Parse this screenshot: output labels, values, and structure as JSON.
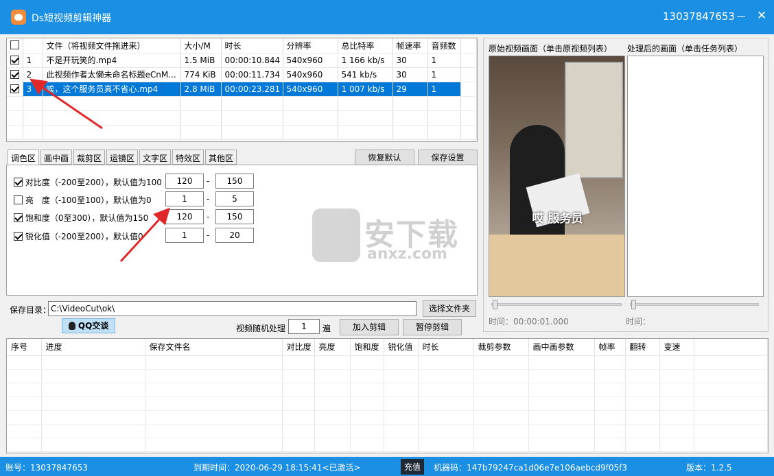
{
  "window": {
    "title": "Ds短视频剪辑神器",
    "account_phone": "13037847653",
    "minimize_icon": "minimize-icon",
    "close_icon": "close-icon",
    "close_glyph": "✕"
  },
  "file_list": {
    "headers": [
      "文件（将视频文件拖进来）",
      "大小/M",
      "时长",
      "分辨率",
      "总比特率",
      "帧速率",
      "音频数"
    ],
    "rows": [
      {
        "no": "1",
        "checked": true,
        "file": "不是开玩笑的.mp4",
        "size": "1.5 MiB",
        "duration": "00:00:10.844",
        "resolution": "540x960",
        "bitrate": "1 166 kb/s",
        "fps": "30",
        "audio": "1"
      },
      {
        "no": "2",
        "checked": true,
        "file": "此视频作者太懒未命名标题eCnM...",
        "size": "774 KiB",
        "duration": "00:00:11.734",
        "resolution": "540x960",
        "bitrate": "541 kb/s",
        "fps": "30",
        "audio": "1"
      },
      {
        "no": "3",
        "checked": true,
        "selected": true,
        "file": "唉，这个服务员真不省心.mp4",
        "size": "2.8 MiB",
        "duration": "00:00:23.281",
        "resolution": "540x960",
        "bitrate": "1 007 kb/s",
        "fps": "29",
        "audio": "1"
      }
    ]
  },
  "tabs": [
    "调色区",
    "画中画",
    "裁剪区",
    "运镜区",
    "文字区",
    "特效区",
    "其他区"
  ],
  "actions": {
    "reset": "恢复默认",
    "save_settings": "保存设置"
  },
  "color_settings": [
    {
      "label": "对比度（-200至200），默认值为100",
      "checked": true,
      "min": "120",
      "max": "150"
    },
    {
      "label": "亮　度（-100至100），默认值为0",
      "checked": false,
      "min": "1",
      "max": "5"
    },
    {
      "label": "饱和度（0至300），默认值为150",
      "checked": true,
      "min": "120",
      "max": "150"
    },
    {
      "label": "锐化值（-200至200），默认值0",
      "checked": true,
      "min": "1",
      "max": "20"
    }
  ],
  "range_separator": "-",
  "watermark": {
    "brand": "安下载",
    "domain": "anxz.com"
  },
  "preview": {
    "original_label": "原始视频画面（单击原视频列表）",
    "processed_label": "处理后的画面（单击任务列表）",
    "subtitle": "哎 服务员",
    "original_time": "时间：00:00:01.000",
    "processed_time": "时间：",
    "original_progress": 0
  },
  "save": {
    "label": "保存目录：",
    "path": "C:\\VideoCut\\ok\\",
    "choose_button": "选择文件夹"
  },
  "qq_button": "QQ交谈",
  "random": {
    "label": "视频随机处理",
    "value": "1",
    "unit": "遍"
  },
  "add_clip": "加入剪辑",
  "pause_clip": "暂停剪辑",
  "tasks": {
    "headers": [
      "序号",
      "进度",
      "保存文件名",
      "对比度",
      "亮度",
      "饱和度",
      "锐化值",
      "时长",
      "裁剪参数",
      "画中画参数",
      "帧率",
      "翻转",
      "变速"
    ]
  },
  "status": {
    "account": "账号：13037847653",
    "expiry": "到期时间：2020-06-29 18:15:41<已激活>",
    "recharge": "充值",
    "machine": "机器码：147b79247ca1d06e7e106aebcd9f05f3",
    "version": "版本：1.2.5"
  },
  "colors": {
    "accent": "#1a8fe3",
    "selection": "#0078d7",
    "arrow": "#e0282a"
  }
}
